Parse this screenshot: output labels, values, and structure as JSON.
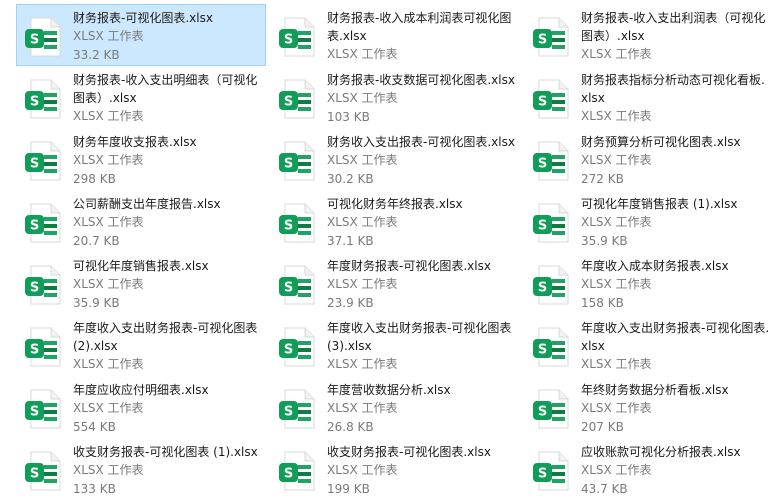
{
  "explorer": {
    "files": [
      {
        "name": "财务报表-可视化图表.xlsx",
        "type": "XLSX 工作表",
        "size": "33.2 KB",
        "selected": true,
        "icon": "xlsx-file-icon"
      },
      {
        "name": "财务报表-收入成本利润表可视化图表.xlsx",
        "type": "XLSX 工作表",
        "size": "",
        "selected": false,
        "icon": "xlsx-file-icon"
      },
      {
        "name": "财务报表-收入支出利润表（可视化图表）.xlsx",
        "type": "XLSX 工作表",
        "size": "",
        "selected": false,
        "icon": "xlsx-file-icon"
      },
      {
        "name": "财务报表-收入支出明细表（可视化图表）.xlsx",
        "type": "XLSX 工作表",
        "size": "",
        "selected": false,
        "icon": "xlsx-file-icon"
      },
      {
        "name": "财务报表-收支数据可视化图表.xlsx",
        "type": "XLSX 工作表",
        "size": "103 KB",
        "selected": false,
        "icon": "xlsx-file-icon"
      },
      {
        "name": "财务报表指标分析动态可视化看板.xlsx",
        "type": "XLSX 工作表",
        "size": "",
        "selected": false,
        "icon": "xlsx-file-icon"
      },
      {
        "name": "财务年度收支报表.xlsx",
        "type": "XLSX 工作表",
        "size": "298 KB",
        "selected": false,
        "icon": "xlsx-file-icon"
      },
      {
        "name": "财务收入支出报表-可视化图表.xlsx",
        "type": "XLSX 工作表",
        "size": "30.2 KB",
        "selected": false,
        "icon": "xlsx-file-icon"
      },
      {
        "name": "财务预算分析可视化图表.xlsx",
        "type": "XLSX 工作表",
        "size": "272 KB",
        "selected": false,
        "icon": "xlsx-file-icon"
      },
      {
        "name": "公司薪酬支出年度报告.xlsx",
        "type": "XLSX 工作表",
        "size": "20.7 KB",
        "selected": false,
        "icon": "xlsx-file-icon"
      },
      {
        "name": "可视化财务年终报表.xlsx",
        "type": "XLSX 工作表",
        "size": "37.1 KB",
        "selected": false,
        "icon": "xlsx-file-icon"
      },
      {
        "name": "可视化年度销售报表 (1).xlsx",
        "type": "XLSX 工作表",
        "size": "35.9 KB",
        "selected": false,
        "icon": "xlsx-file-icon"
      },
      {
        "name": "可视化年度销售报表.xlsx",
        "type": "XLSX 工作表",
        "size": "35.9 KB",
        "selected": false,
        "icon": "xlsx-file-icon"
      },
      {
        "name": "年度财务报表-可视化图表.xlsx",
        "type": "XLSX 工作表",
        "size": "23.9 KB",
        "selected": false,
        "icon": "xlsx-file-icon"
      },
      {
        "name": "年度收入成本财务报表.xlsx",
        "type": "XLSX 工作表",
        "size": "158 KB",
        "selected": false,
        "icon": "xlsx-file-icon"
      },
      {
        "name": "年度收入支出财务报表-可视化图表(2).xlsx",
        "type": "XLSX 工作表",
        "size": "",
        "selected": false,
        "icon": "xlsx-file-icon"
      },
      {
        "name": "年度收入支出财务报表-可视化图表(3).xlsx",
        "type": "XLSX 工作表",
        "size": "",
        "selected": false,
        "icon": "xlsx-file-icon"
      },
      {
        "name": "年度收入支出财务报表-可视化图表.xlsx",
        "type": "XLSX 工作表",
        "size": "",
        "selected": false,
        "icon": "xlsx-file-icon"
      },
      {
        "name": "年度应收应付明细表.xlsx",
        "type": "XLSX 工作表",
        "size": "554 KB",
        "selected": false,
        "icon": "xlsx-file-icon"
      },
      {
        "name": "年度营收数据分析.xlsx",
        "type": "XLSX 工作表",
        "size": "26.8 KB",
        "selected": false,
        "icon": "xlsx-file-icon"
      },
      {
        "name": "年终财务数据分析看板.xlsx",
        "type": "XLSX 工作表",
        "size": "207 KB",
        "selected": false,
        "icon": "xlsx-file-icon"
      },
      {
        "name": "收支财务报表-可视化图表 (1).xlsx",
        "type": "XLSX 工作表",
        "size": "133 KB",
        "selected": false,
        "icon": "xlsx-file-icon"
      },
      {
        "name": "收支财务报表-可视化图表.xlsx",
        "type": "XLSX 工作表",
        "size": "199 KB",
        "selected": false,
        "icon": "xlsx-file-icon"
      },
      {
        "name": "应收账款可视化分析报表.xlsx",
        "type": "XLSX 工作表",
        "size": "43.7 KB",
        "selected": false,
        "icon": "xlsx-file-icon"
      }
    ],
    "icon_colors": {
      "green_dark": "#107c41",
      "green_light": "#21a366",
      "badge": "#0f9d58",
      "page": "#ffffff",
      "page_edge": "#d8d8d8"
    },
    "icon_letter": "S"
  }
}
